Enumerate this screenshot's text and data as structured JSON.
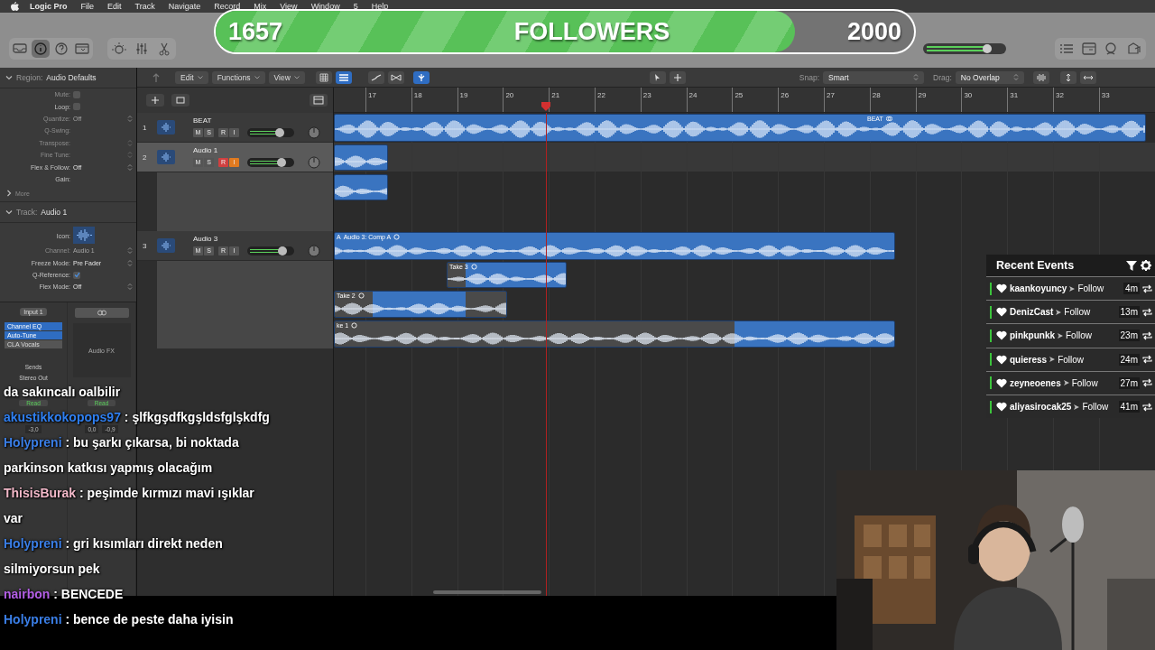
{
  "menu_bar": {
    "app_name": "Logic Pro",
    "items": [
      "File",
      "Edit",
      "Track",
      "Navigate",
      "Record",
      "Mix",
      "View",
      "Window",
      "5",
      "Help"
    ]
  },
  "follower_goal": {
    "count": "1657",
    "label": "FOLLOWERS",
    "goal": "2000",
    "level": 0.83
  },
  "toolbar": {
    "view_buttons": [
      {
        "kind": "library",
        "selected": false
      },
      {
        "kind": "inspector",
        "selected": true
      },
      {
        "kind": "help",
        "selected": false
      },
      {
        "kind": "toolbar",
        "selected": false
      }
    ],
    "edit_buttons": [
      {
        "kind": "brightness"
      },
      {
        "kind": "mixer"
      },
      {
        "kind": "scissors"
      }
    ],
    "master_volume": {
      "level": 0.8
    },
    "window_buttons": [
      {
        "kind": "list"
      },
      {
        "kind": "browser"
      },
      {
        "kind": "loops"
      },
      {
        "kind": "bundle"
      }
    ]
  },
  "inspector": {
    "region": {
      "title": "Region:",
      "name": "Audio Defaults",
      "expanded": true,
      "fields": [
        {
          "label": "Mute:",
          "kind": "checkbox",
          "checked": false,
          "disabled": true
        },
        {
          "label": "Loop:",
          "kind": "checkbox",
          "checked": false,
          "disabled": false
        },
        {
          "label": "Quantize:",
          "kind": "select",
          "value": "Off",
          "disabled": true
        },
        {
          "label": "Q-Swing:",
          "kind": "blank",
          "disabled": true
        },
        {
          "label": "Transpose:",
          "kind": "stepper",
          "disabled": true
        },
        {
          "label": "Fine Tune:",
          "kind": "stepper",
          "disabled": true
        },
        {
          "label": "Flex & Follow:",
          "kind": "select",
          "value": "Off",
          "disabled": false
        },
        {
          "label": "Gain:",
          "kind": "blank",
          "disabled": false
        }
      ],
      "more": "More"
    },
    "track": {
      "title": "Track:",
      "name": "Audio 1",
      "expanded": true,
      "fields": [
        {
          "label": "Icon:",
          "kind": "icon",
          "disabled": false
        },
        {
          "label": "Channel:",
          "kind": "select",
          "value": "Audio 1",
          "disabled": true
        },
        {
          "label": "Freeze Mode:",
          "kind": "select",
          "value": "Pre Fader",
          "disabled": false
        },
        {
          "label": "Q-Reference:",
          "kind": "checkbox",
          "checked": true,
          "disabled": false
        },
        {
          "label": "Flex Mode:",
          "kind": "select",
          "value": "Off",
          "disabled": false
        }
      ]
    },
    "channel_strip": {
      "input": "Input 1",
      "plugins": [
        {
          "name": "Channel EQ",
          "on": true
        },
        {
          "name": "Auto-Tune",
          "on": true
        },
        {
          "name": "CLA Vocals",
          "on": false
        }
      ],
      "audio_fx": "Audio FX",
      "sends": "Sends",
      "output": "Stereo Out",
      "automation": [
        "Read",
        "Read"
      ],
      "readings": [
        "-3,0",
        "0,0",
        "-0,9"
      ]
    }
  },
  "arrange": {
    "menus": [
      "Edit",
      "Functions",
      "View"
    ],
    "snap_label": "Snap:",
    "snap": "Smart",
    "drag_label": "Drag:",
    "drag": "No Overlap",
    "ruler": [
      "17",
      "18",
      "19",
      "20",
      "21",
      "22",
      "23",
      "24",
      "25",
      "26",
      "27",
      "28",
      "29",
      "30",
      "31",
      "32",
      "33"
    ],
    "tracks": [
      {
        "number": "1",
        "name": "BEAT",
        "selected": false,
        "level": 0.72,
        "controls": [
          {
            "label": "M",
            "on": false
          },
          {
            "label": "S",
            "on": false
          },
          {
            "label": "R",
            "on": false
          },
          {
            "label": "I",
            "on": false
          }
        ]
      },
      {
        "number": "2",
        "name": "Audio 1",
        "selected": true,
        "level": 0.76,
        "controls": [
          {
            "label": "M",
            "on": false
          },
          {
            "label": "S",
            "on": false
          },
          {
            "label": "R",
            "on": true
          },
          {
            "label": "I",
            "on": true
          }
        ]
      },
      {
        "number": "3",
        "name": "Audio 3",
        "selected": false,
        "level": 0.78,
        "controls": [
          {
            "label": "M",
            "on": false
          },
          {
            "label": "S",
            "on": false
          },
          {
            "label": "R",
            "on": false
          },
          {
            "label": "I",
            "on": false
          }
        ]
      }
    ],
    "regions": [
      {
        "kind": "beat",
        "label": "BEAT"
      },
      {
        "kind": "take"
      },
      {
        "kind": "take"
      },
      {
        "kind": "comp",
        "badge": "A",
        "label": "Audio 3: Comp A"
      },
      {
        "kind": "take",
        "label": "Take 3"
      },
      {
        "kind": "take",
        "label": "Take 2"
      },
      {
        "kind": "take",
        "label": "ke 1"
      }
    ]
  },
  "chat": {
    "messages": [
      {
        "text": "da sakıncalı oalbilir"
      },
      {
        "user": "akustikkokopops97",
        "color": "#2f7ff0",
        "separator": ":",
        "text": "şlfkgşdfkgşldsfglşkdfg"
      },
      {
        "user": "Holypreni",
        "color": "#3a7ee6",
        "separator": ":",
        "text": "bu şarkı çıkarsa, bi noktada parkinson katkısı yapmış olacağım"
      },
      {
        "user": "ThisisBurak",
        "color": "#f2b8c8",
        "separator": ":",
        "text": "peşimde kırmızı mavi ışıklar var"
      },
      {
        "user": "Holypreni",
        "color": "#3a7ee6",
        "separator": ":",
        "text": "gri kısımları direkt neden silmiyorsun pek"
      },
      {
        "user": "nairbon",
        "color": "#b45fe6",
        "separator": ":",
        "text": "BENCEDE"
      },
      {
        "user": "Holypreni",
        "color": "#3a7ee6",
        "separator": ":",
        "text": "bence de peste daha iyisin"
      }
    ]
  },
  "recent_events": {
    "title": "Recent Events",
    "events": [
      {
        "user": "kaankoyuncy",
        "action": "Follow",
        "time": "4m"
      },
      {
        "user": "DenizCast",
        "action": "Follow",
        "time": "13m"
      },
      {
        "user": "pinkpunkk",
        "action": "Follow",
        "time": "23m"
      },
      {
        "user": "quieress",
        "action": "Follow",
        "time": "24m"
      },
      {
        "user": "zeyneoenes",
        "action": "Follow",
        "time": "27m"
      },
      {
        "user": "aliyasirocak25",
        "action": "Follow",
        "time": "41m"
      }
    ]
  }
}
